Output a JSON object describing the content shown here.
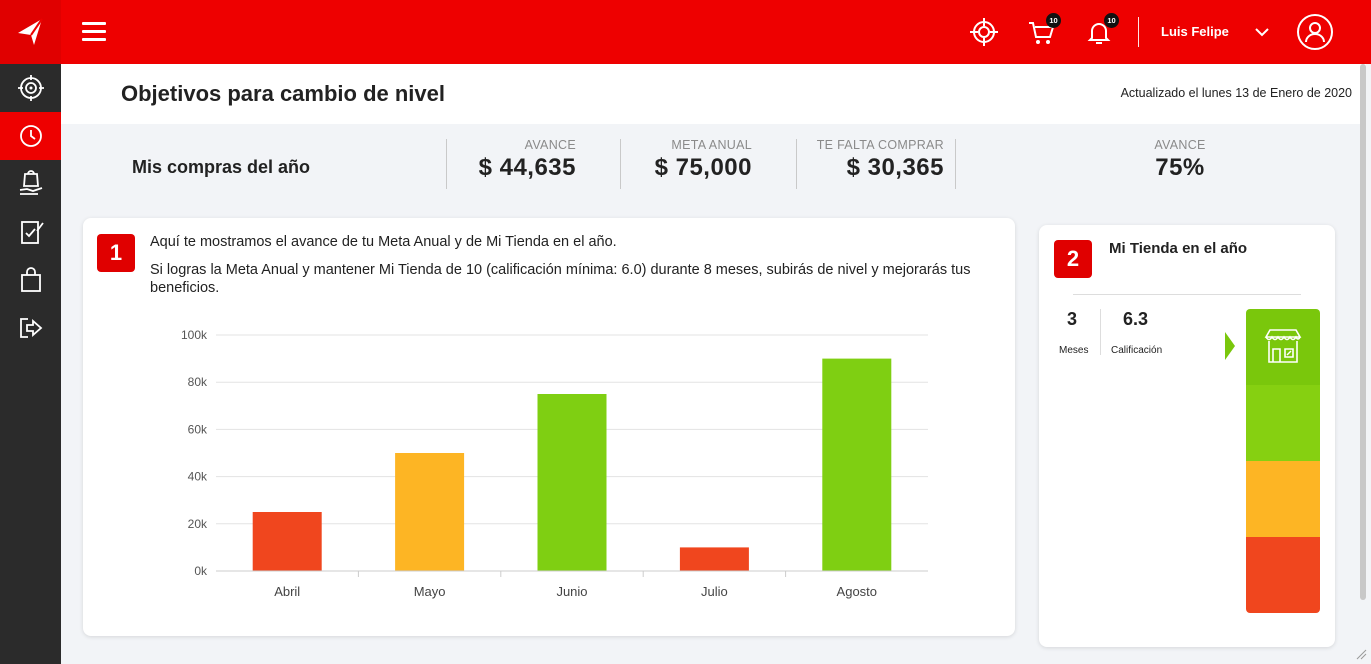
{
  "header": {
    "user_name": "Luis Felipe",
    "cart_badge": "10",
    "notifications_badge": "10",
    "brand_color": "#ee0000"
  },
  "sidebar": {
    "items": [
      {
        "icon": "target-icon",
        "active": false
      },
      {
        "icon": "clock-icon",
        "active": true
      },
      {
        "icon": "hand-bag-icon",
        "active": false
      },
      {
        "icon": "clipboard-check-icon",
        "active": false
      },
      {
        "icon": "shopping-bag-icon",
        "active": false
      },
      {
        "icon": "logout-icon",
        "active": false
      }
    ]
  },
  "page": {
    "title": "Objetivos para cambio de nivel",
    "updated": "Actualizado el lunes 13 de Enero de 2020"
  },
  "stats": {
    "title": "Mis compras del año",
    "items": [
      {
        "label": "AVANCE",
        "value": "$ 44,635"
      },
      {
        "label": "META ANUAL",
        "value": "$ 75,000"
      },
      {
        "label": "TE FALTA COMPRAR",
        "value": "$ 30,365"
      },
      {
        "label": "AVANCE",
        "value": "75%"
      }
    ]
  },
  "card1": {
    "number": "1",
    "line1": "Aquí te mostramos el avance de tu Meta Anual y de Mi Tienda en el año.",
    "line2": "Si logras la Meta Anual y mantener Mi Tienda de 10 (calificación mínima: 6.0) durante 8 meses, subirás de nivel y mejorarás tus beneficios."
  },
  "chart_data": {
    "type": "bar",
    "categories": [
      "Abril",
      "Mayo",
      "Junio",
      "Julio",
      "Agosto"
    ],
    "values": [
      25000,
      50000,
      75000,
      10000,
      90000
    ],
    "colors": [
      "#f0461e",
      "#fdb524",
      "#7fcf12",
      "#f0461e",
      "#7fcf12"
    ],
    "yticks": [
      "0k",
      "20k",
      "40k",
      "60k",
      "80k",
      "100k"
    ],
    "ylim": [
      0,
      100000
    ],
    "grid": true
  },
  "card2": {
    "number": "2",
    "title": "Mi Tienda en el año",
    "months_value": "3",
    "months_label": "Meses",
    "rating_value": "6.3",
    "rating_label": "Calificación",
    "scale_colors": [
      "#7ac70c",
      "#86d011",
      "#fdb524",
      "#f0461e"
    ]
  }
}
